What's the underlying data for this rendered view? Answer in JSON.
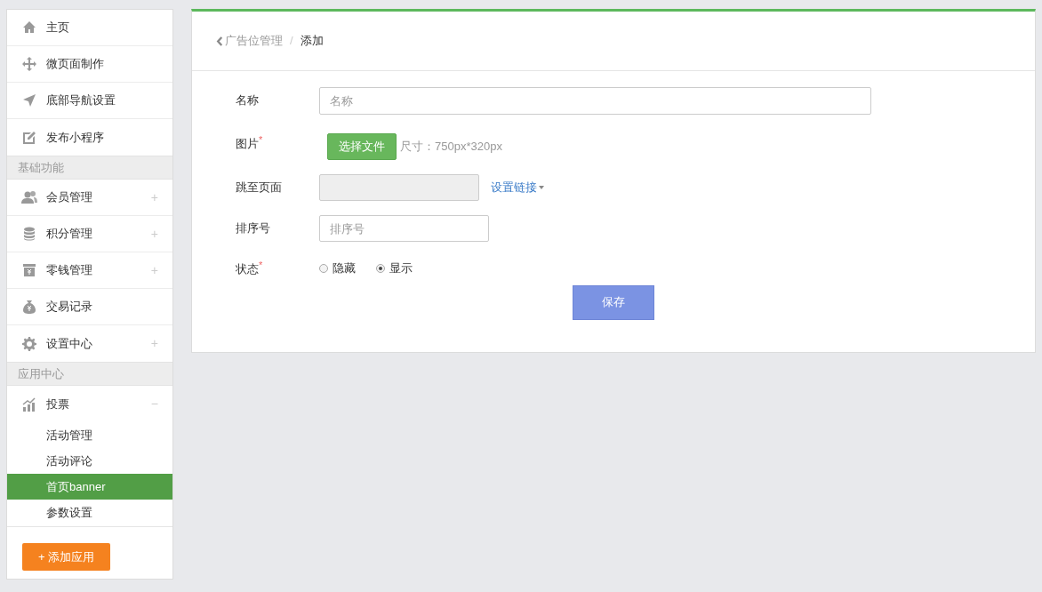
{
  "sidebar": {
    "sections": [
      {
        "items": [
          {
            "label": "主页"
          },
          {
            "label": "微页面制作"
          },
          {
            "label": "底部导航设置"
          },
          {
            "label": "发布小程序"
          }
        ]
      },
      {
        "title": "基础功能",
        "items": [
          {
            "label": "会员管理",
            "toggle": "+"
          },
          {
            "label": "积分管理",
            "toggle": "+"
          },
          {
            "label": "零钱管理",
            "toggle": "+"
          },
          {
            "label": "交易记录"
          },
          {
            "label": "设置中心",
            "toggle": "+"
          }
        ]
      },
      {
        "title": "应用中心",
        "items": [
          {
            "label": "投票",
            "toggle": "−",
            "children": [
              {
                "label": "活动管理",
                "selected": false
              },
              {
                "label": "活动评论",
                "selected": false
              },
              {
                "label": "首页banner",
                "selected": true
              },
              {
                "label": "参数设置",
                "selected": false
              }
            ]
          }
        ]
      }
    ],
    "add_button": "+ 添加应用"
  },
  "breadcrumb": {
    "back": "广告位管理",
    "separator": "/",
    "current": "添加"
  },
  "form": {
    "fields": [
      {
        "kind": "text",
        "label": "名称",
        "placeholder": "名称"
      },
      {
        "kind": "file",
        "label": "图片$^{*}$",
        "button": "选择文件",
        "hint": "尺寸：750px*320px"
      },
      {
        "kind": "link",
        "label": "跳至页面",
        "link": "设置链接"
      },
      {
        "kind": "short",
        "label": "排序号",
        "placeholder": "排序号"
      },
      {
        "kind": "radio",
        "label": "状态$^{*}$",
        "options": [
          {
            "label": "隐藏",
            "selected": false
          },
          {
            "label": "显示",
            "selected": true
          }
        ]
      }
    ],
    "submit": "保存"
  }
}
